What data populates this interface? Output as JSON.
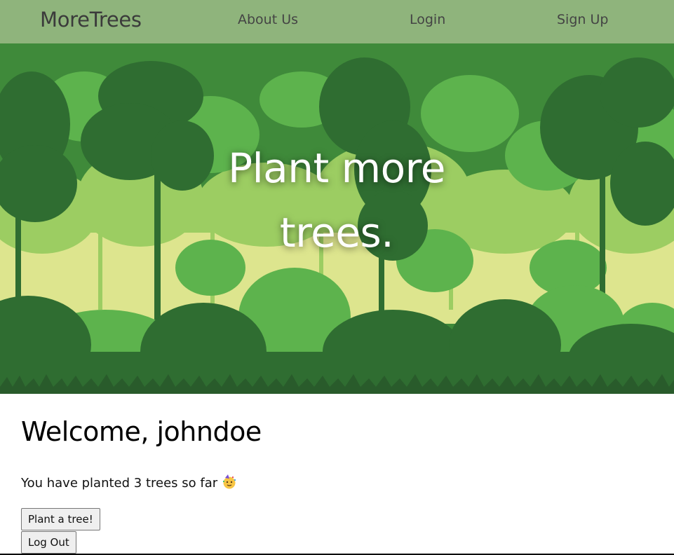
{
  "navbar": {
    "brand": "MoreTrees",
    "links": [
      "About Us",
      "Login",
      "Sign Up"
    ],
    "background": "#8fb47c"
  },
  "hero": {
    "title_line1": "Plant more",
    "title_line2": "trees.",
    "palette": [
      "#3f8a3a",
      "#2f6d31",
      "#5db34d",
      "#9ccd62",
      "#dde58e"
    ]
  },
  "main": {
    "welcome": "Welcome, johndoe",
    "trees_text": "You have planted 3 trees so far",
    "emoji_icon": "party-face-icon",
    "plant_button": "Plant a tree!",
    "logout_button": "Log Out"
  }
}
